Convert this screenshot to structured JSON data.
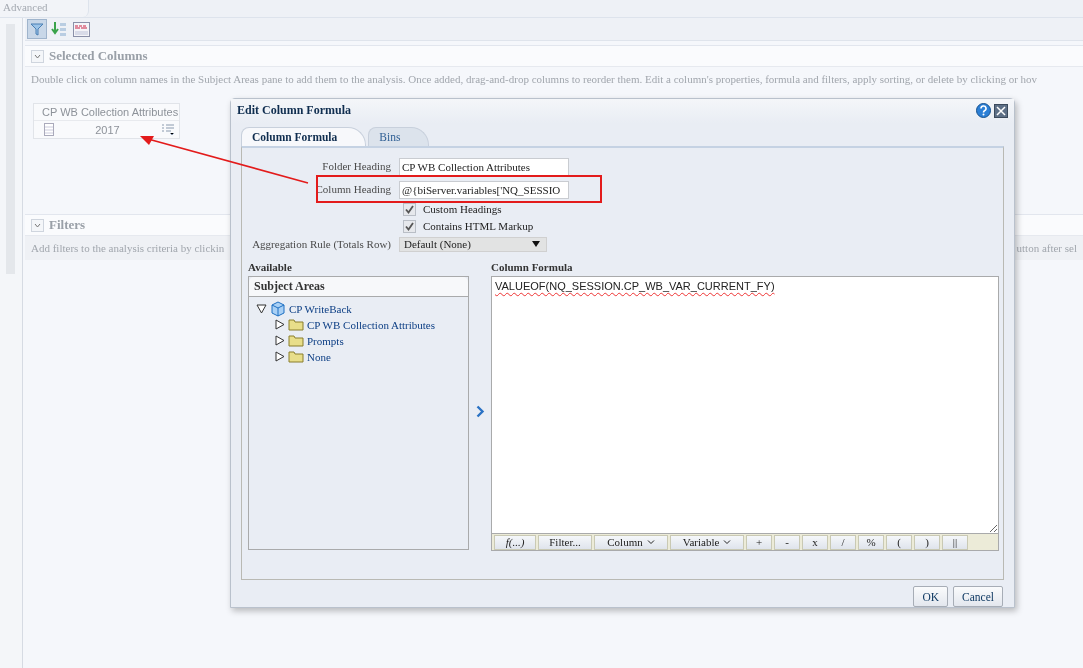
{
  "page_tab": "Advanced",
  "selected_columns": {
    "title": "Selected Columns",
    "description": "Double click on column names in the Subject Areas pane to add them to the analysis. Once added, drag-and-drop columns to reorder them. Edit a column's properties, formula and filters, apply sorting, or delete by clicking or hov",
    "column_card": {
      "folder": "CP WB Collection Attributes",
      "value": "2017"
    }
  },
  "filters": {
    "title": "Filters",
    "description_left": "Add filters to the analysis criteria by clickin",
    "description_right": "utton after sel"
  },
  "dialog": {
    "title": "Edit Column Formula",
    "tabs": [
      {
        "label": "Column Formula",
        "selected": true
      },
      {
        "label": "Bins",
        "selected": false
      }
    ],
    "fields": [
      {
        "label": "Folder Heading",
        "value": "CP WB Collection Attributes",
        "highlighted": false
      },
      {
        "label": "Column Heading",
        "value": "@{biServer.variables['NQ_SESSIO",
        "highlighted": true
      }
    ],
    "checkboxes": [
      {
        "label": "Custom Headings",
        "checked": true
      },
      {
        "label": "Contains HTML Markup",
        "checked": true
      }
    ],
    "aggregation": {
      "label": "Aggregation Rule (Totals Row)",
      "value": "Default (None)"
    },
    "available": {
      "title": "Available",
      "panel_title": "Subject Areas",
      "tree": [
        {
          "label": "CP WriteBack",
          "kind": "subject-area",
          "expanded": true,
          "children": [
            {
              "label": "CP WB Collection Attributes",
              "kind": "folder",
              "expanded": false
            },
            {
              "label": "Prompts",
              "kind": "folder",
              "expanded": false
            },
            {
              "label": "None",
              "kind": "folder",
              "expanded": false
            }
          ]
        }
      ]
    },
    "formula": {
      "title": "Column Formula",
      "value": "VALUEOF(NQ_SESSION.CP_WB_VAR_CURRENT_FY)"
    },
    "formula_buttons": [
      {
        "label": "f(...)",
        "kind": "function"
      },
      {
        "label": "Filter...",
        "kind": "plain"
      },
      {
        "label": "Column",
        "kind": "dropdown"
      },
      {
        "label": "Variable",
        "kind": "dropdown"
      },
      {
        "label": "+",
        "kind": "plain"
      },
      {
        "label": "-",
        "kind": "plain"
      },
      {
        "label": "x",
        "kind": "plain"
      },
      {
        "label": "/",
        "kind": "plain"
      },
      {
        "label": "%",
        "kind": "plain"
      },
      {
        "label": "(",
        "kind": "plain"
      },
      {
        "label": ")",
        "kind": "plain"
      },
      {
        "label": "||",
        "kind": "plain"
      }
    ],
    "buttons": [
      "OK",
      "Cancel"
    ]
  }
}
